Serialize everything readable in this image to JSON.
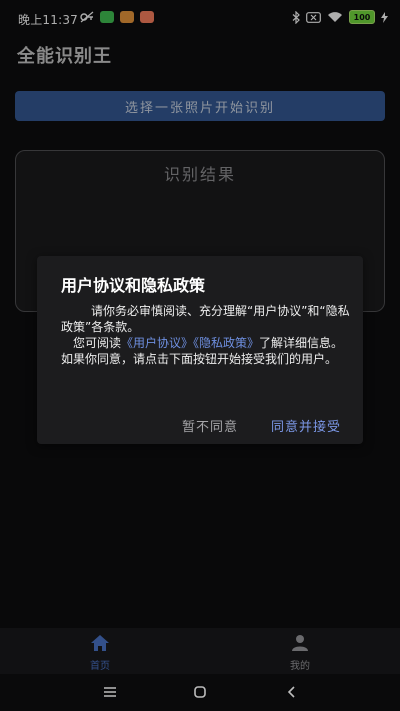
{
  "status_bar": {
    "time": "晚上11:37",
    "battery": "100",
    "colors": {
      "notif_green": "#3fb950",
      "notif_orange": "#e0903a",
      "notif_coral": "#f07a5a"
    }
  },
  "app_bar": {
    "title": "全能识别王"
  },
  "main": {
    "select_button_label": "选择一张照片开始识别",
    "result_title": "识别结果"
  },
  "dialog": {
    "title": "用户协议和隐私政策",
    "para1": "请你务必审慎阅读、充分理解“用户协议”和“隐私政策”各条款。",
    "para2_prefix": "您可阅读",
    "user_agreement_link": "《用户协议》",
    "privacy_link": "《隐私政策》",
    "para2_suffix": "了解详细信息。如果你同意，请点击下面按钮开始接受我们的用户。",
    "disagree_label": "暂不同意",
    "agree_label": "同意并接受"
  },
  "bottom_nav": {
    "items": [
      {
        "label": "首页",
        "icon": "home-icon",
        "active": true
      },
      {
        "label": "我的",
        "icon": "person-icon",
        "active": false
      }
    ],
    "colors": {
      "active": "#33508a",
      "inactive": "#6a6a6d"
    }
  },
  "system_nav": {
    "icons": [
      "menu-icon",
      "home-circle-icon",
      "back-icon"
    ]
  },
  "colors": {
    "accent_button": "#32558e",
    "dialog_link": "#6e8fe0",
    "dialog_positive": "#7b97e6"
  }
}
